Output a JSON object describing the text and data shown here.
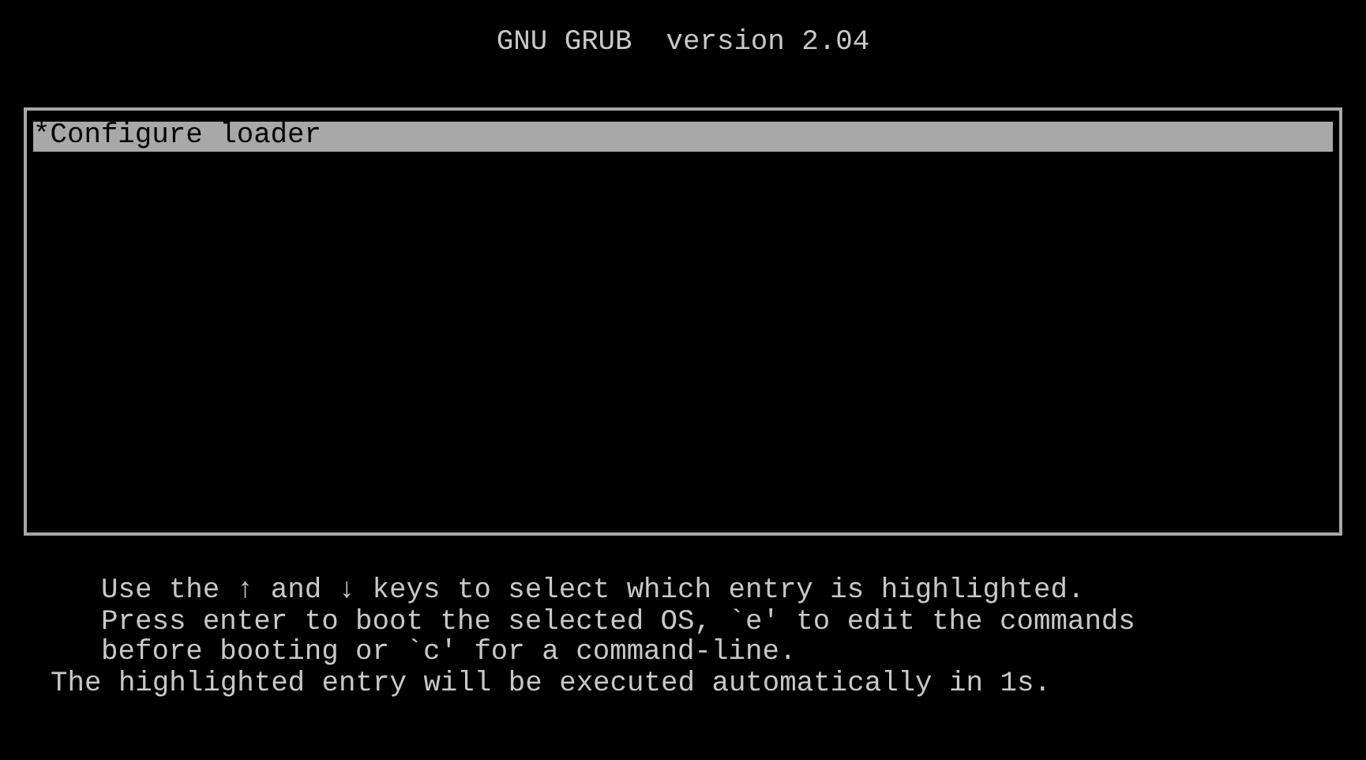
{
  "title": "GNU GRUB  version 2.04",
  "menu": {
    "entries": [
      {
        "label": "*Configure loader",
        "selected": true
      }
    ]
  },
  "help_lines": [
    {
      "kind": "indented",
      "text": "Use the ↑ and ↓ keys to select which entry is highlighted."
    },
    {
      "kind": "indented",
      "text": "Press enter to boot the selected OS, `e' to edit the commands"
    },
    {
      "kind": "indented",
      "text": "before booting or `c' for a command-line."
    },
    {
      "kind": "plain",
      "text": "The highlighted entry will be executed automatically in 1s."
    }
  ]
}
